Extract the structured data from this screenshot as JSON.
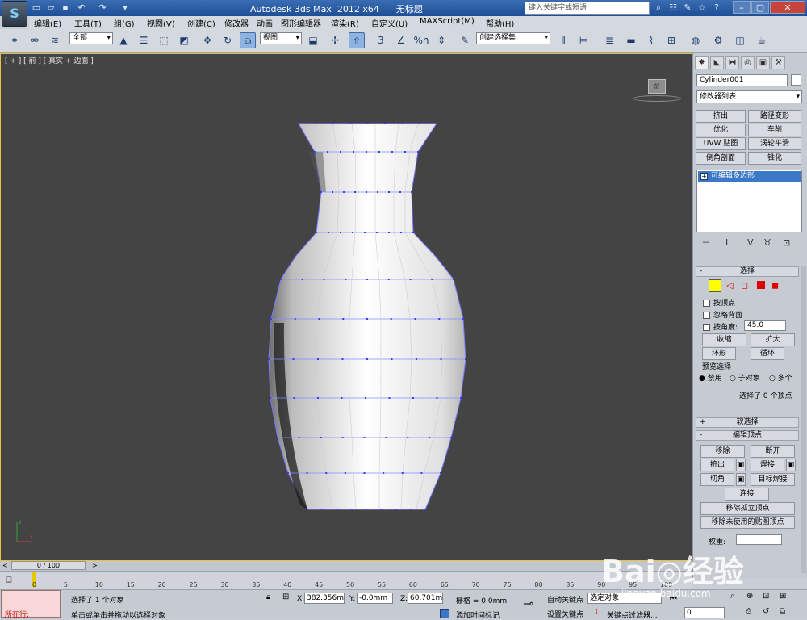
{
  "app": {
    "title": "Autodesk 3ds Max  2012 x64      无标题",
    "logo_text": "S",
    "search_placeholder": "键入关键字或短语"
  },
  "menus": [
    "编辑(E)",
    "工具(T)",
    "组(G)",
    "视图(V)",
    "创建(C)",
    "修改器",
    "动画",
    "图形编辑器",
    "渲染(R)",
    "自定义(U)",
    "MAXScript(M)",
    "帮助(H)"
  ],
  "toolbar": {
    "filter_value": "全部",
    "ref_coord_value": "视图",
    "selection_set_value": "创建选择集",
    "snap_label": "3",
    "percent_label": "%n"
  },
  "viewport": {
    "label": "[ + ] [ 前 ] [ 真实 + 边面 ]",
    "viewcube_label": "前"
  },
  "command_panel": {
    "object_name": "Cylinder001",
    "modifier_list": "修改器列表",
    "modifier_buttons": [
      "挤出",
      "路径变形",
      "优化",
      "车削",
      "UVW 贴图",
      "涡轮平滑",
      "倒角剖面",
      "锥化"
    ],
    "stack_item": "可编辑多边形",
    "selection": {
      "title": "选择",
      "by_vertex": "按顶点",
      "ignore_backfacing": "忽略背面",
      "by_angle": "按角度:",
      "angle_value": "45.0",
      "shrink": "收缩",
      "grow": "扩大",
      "ring": "环形",
      "loop": "循环",
      "preview_title": "预览选择",
      "preview_off": "禁用",
      "preview_sub": "子对象",
      "preview_multi": "多个",
      "status": "选择了 0 个顶点"
    },
    "soft_selection": "软选择",
    "edit_vertices": {
      "title": "编辑顶点",
      "remove": "移除",
      "break": "断开",
      "extrude": "挤出",
      "weld": "焊接",
      "chamfer": "切角",
      "target_weld": "目标焊接",
      "connect": "连接",
      "remove_isolated": "移除孤立顶点",
      "remove_unused": "移除未使用的贴图顶点",
      "weight": "权重:"
    }
  },
  "timeline": {
    "slider": "0 / 100",
    "ticks": [
      "0",
      "5",
      "10",
      "15",
      "20",
      "25",
      "30",
      "35",
      "40",
      "45",
      "50",
      "55",
      "60",
      "65",
      "70",
      "75",
      "80",
      "85",
      "90",
      "95",
      "100"
    ]
  },
  "status": {
    "maxscript": "所在行:",
    "selected": "选择了 1 个对象",
    "prompt": "单击或单击并拖动以选择对象",
    "x_label": "X:",
    "x_value": "382.356mm",
    "y_label": "Y:",
    "y_value": "-0.0mm",
    "z_label": "Z:",
    "z_value": "60.701mm",
    "grid": "栅格 = 0.0mm",
    "add_time_tag": "添加时间标记",
    "auto_key": "自动关键点",
    "set_key": "设置关键点",
    "key_mode": "选定对象",
    "key_filters": "关键点过滤器...",
    "frame": "0"
  },
  "watermark": {
    "brand": "Bai◎经验",
    "url": "jingyan.baidu.com"
  },
  "colors": {
    "viewport_bg": "#444444",
    "viewport_border": "#e7c23a",
    "selection_blue": "#3c78c8",
    "vertex_color": "#3a3aff"
  }
}
